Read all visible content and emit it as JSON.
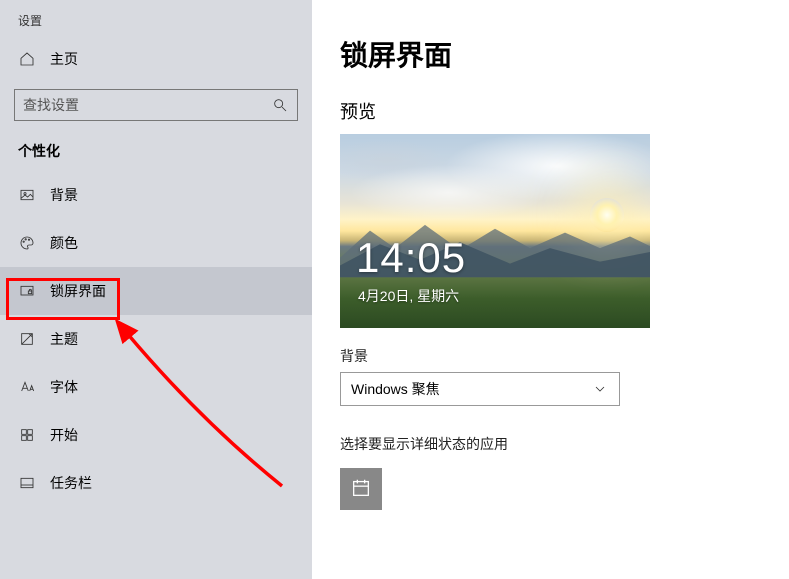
{
  "window_title": "设置",
  "home_label": "主页",
  "search": {
    "placeholder": "查找设置"
  },
  "section_title": "个性化",
  "nav": {
    "items": [
      {
        "label": "背景"
      },
      {
        "label": "颜色"
      },
      {
        "label": "锁屏界面"
      },
      {
        "label": "主题"
      },
      {
        "label": "字体"
      },
      {
        "label": "开始"
      },
      {
        "label": "任务栏"
      }
    ]
  },
  "page": {
    "title": "锁屏界面",
    "preview_heading": "预览",
    "preview_time": "14:05",
    "preview_date": "4月20日, 星期六",
    "bg_label": "背景",
    "bg_selected": "Windows 聚焦",
    "detailed_status_label": "选择要显示详细状态的应用"
  }
}
